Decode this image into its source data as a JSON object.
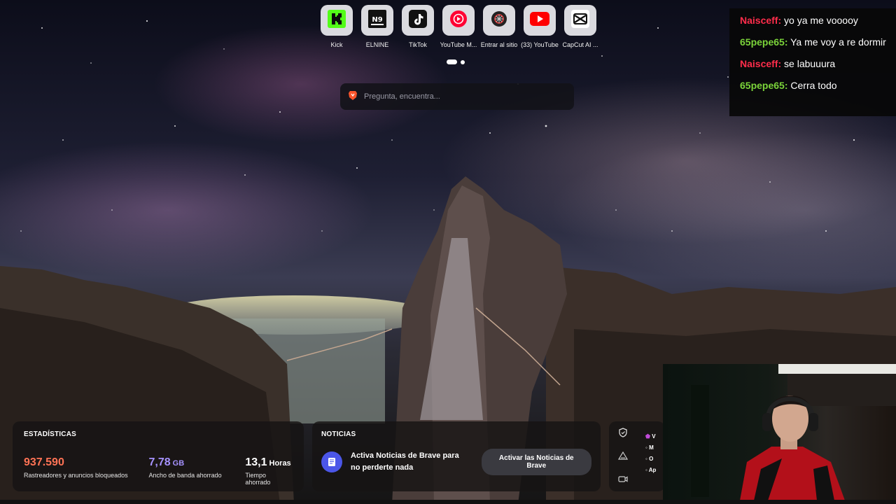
{
  "top_sites": [
    {
      "label": "Kick",
      "icon": "kick-icon"
    },
    {
      "label": "ELNINE",
      "icon": "elnine-icon"
    },
    {
      "label": "TikTok",
      "icon": "tiktok-icon"
    },
    {
      "label": "YouTube M...",
      "icon": "youtube-music-icon"
    },
    {
      "label": "Entrar al sitio",
      "icon": "site-icon"
    },
    {
      "label": "(33) YouTube",
      "icon": "youtube-icon"
    },
    {
      "label": "CapCut AI ...",
      "icon": "capcut-icon"
    }
  ],
  "search": {
    "placeholder": "Pregunta, encuentra..."
  },
  "chat": {
    "messages": [
      {
        "user": "Naisceff",
        "text": " yo ya me vooooy",
        "color": "#ff2d4b"
      },
      {
        "user": "65pepe65",
        "text": " Ya me voy a re dormir",
        "color": "#7bd43a"
      },
      {
        "user": "Naisceff",
        "text": " se labuuura",
        "color": "#ff2d4b"
      },
      {
        "user": "65pepe65",
        "text": " Cerra todo",
        "color": "#7bd43a"
      }
    ]
  },
  "stats": {
    "title": "ESTADÍSTICAS",
    "trackers": {
      "value": "937.590",
      "label": "Rastreadores y anuncios bloqueados",
      "color": "#ff7355"
    },
    "bandwidth": {
      "value": "7,78",
      "unit": "GB",
      "label": "Ancho de banda ahorrado",
      "color": "#a692ff"
    },
    "time": {
      "value": "13,1",
      "unit": "Horas",
      "label": "Tiempo ahorrado",
      "color": "#ffffff"
    }
  },
  "news": {
    "title": "NOTICIAS",
    "text": "Activa Noticias de Brave para no perderte nada",
    "button": "Activar las Noticias de Brave"
  },
  "side_panel": {
    "title": "V",
    "items": [
      "M",
      "O",
      "Ap"
    ]
  }
}
